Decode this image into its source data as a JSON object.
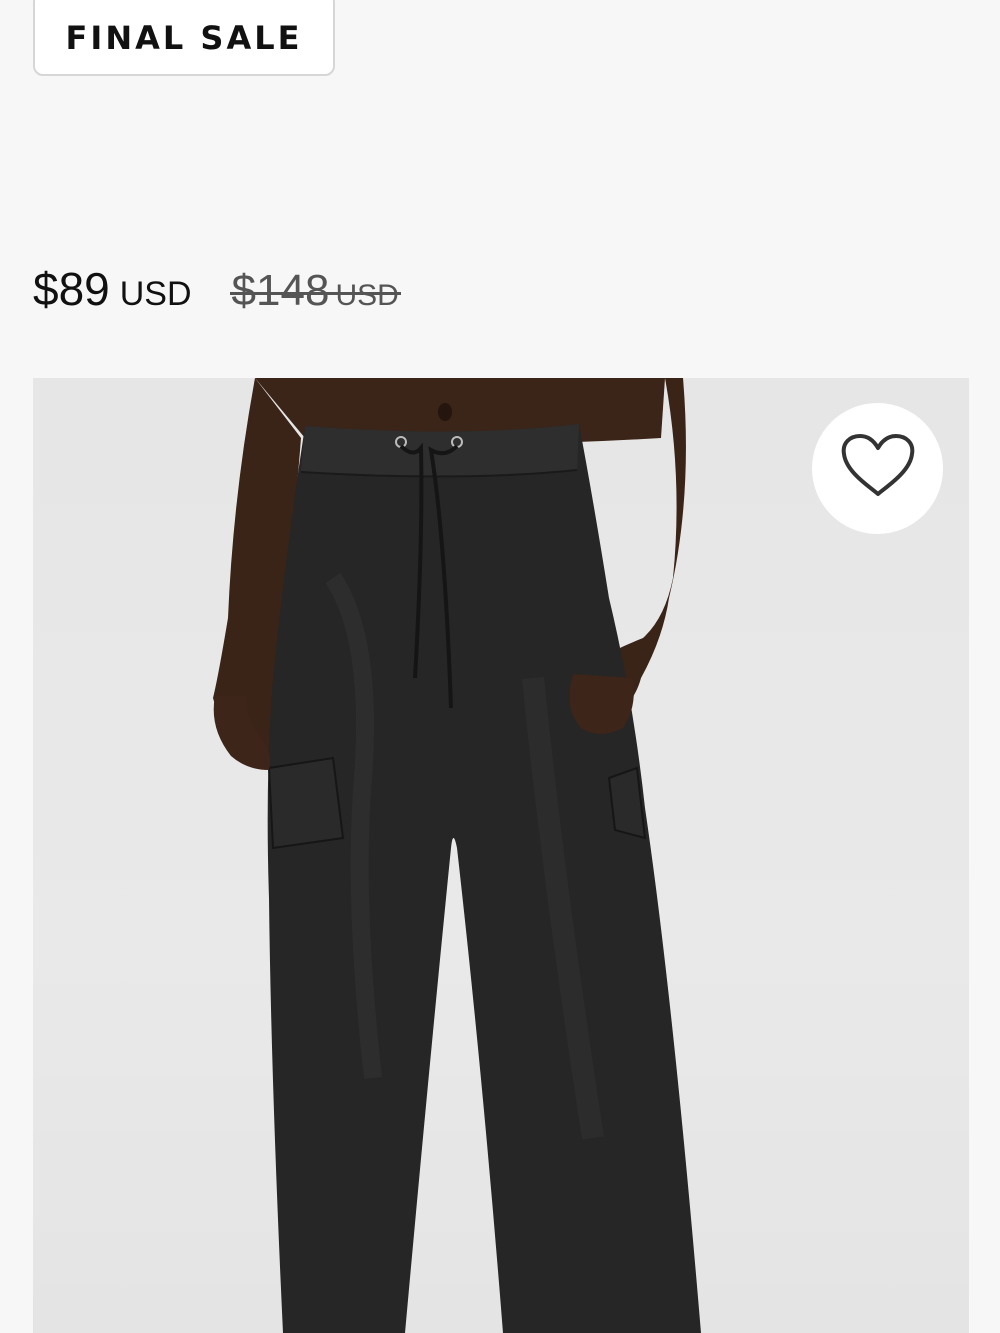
{
  "badge": {
    "label": "FINAL SALE"
  },
  "price": {
    "current": "$89",
    "current_currency": "USD",
    "original": "$148",
    "original_currency": "USD"
  },
  "product_image": {
    "alt": "Black wide-leg cargo pants with drawstring waist on model"
  },
  "wishlist": {
    "icon": "heart-outline-icon",
    "aria_label": "Add to wishlist"
  },
  "colors": {
    "page_background": "#f7f7f7",
    "text": "#111111",
    "strikethrough_text": "#555555",
    "image_background": "#e6e6e6",
    "product_color": "#262626"
  }
}
